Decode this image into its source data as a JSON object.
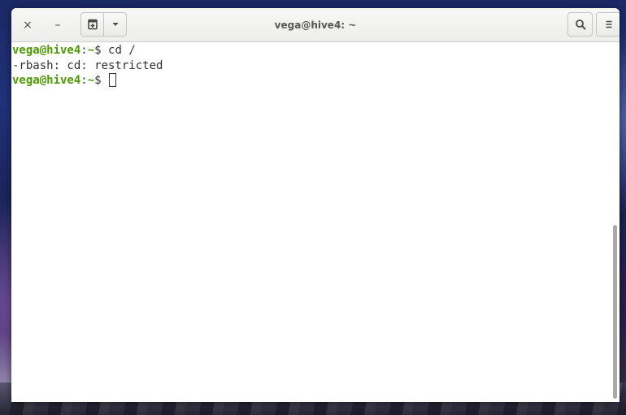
{
  "window": {
    "title": "vega@hive4: ~"
  },
  "headerbar": {
    "close_glyph": "×",
    "minimize_glyph": "–",
    "new_tab_icon": "terminal-tab-icon",
    "dropdown_icon": "chevron-down-icon",
    "search_icon": "search-icon",
    "menu_icon": "hamburger-menu-icon"
  },
  "terminal": {
    "lines": [
      {
        "user": "vega@hive4",
        "sep": ":",
        "path": "~",
        "symbol": "$ ",
        "command": "cd /"
      },
      {
        "output": "-rbash: cd: restricted"
      },
      {
        "user": "vega@hive4",
        "sep": ":",
        "path": "~",
        "symbol": "$ ",
        "command": ""
      }
    ]
  },
  "colors": {
    "prompt_green": "#4e9a06",
    "text": "#2e3436",
    "background": "#ffffff"
  }
}
